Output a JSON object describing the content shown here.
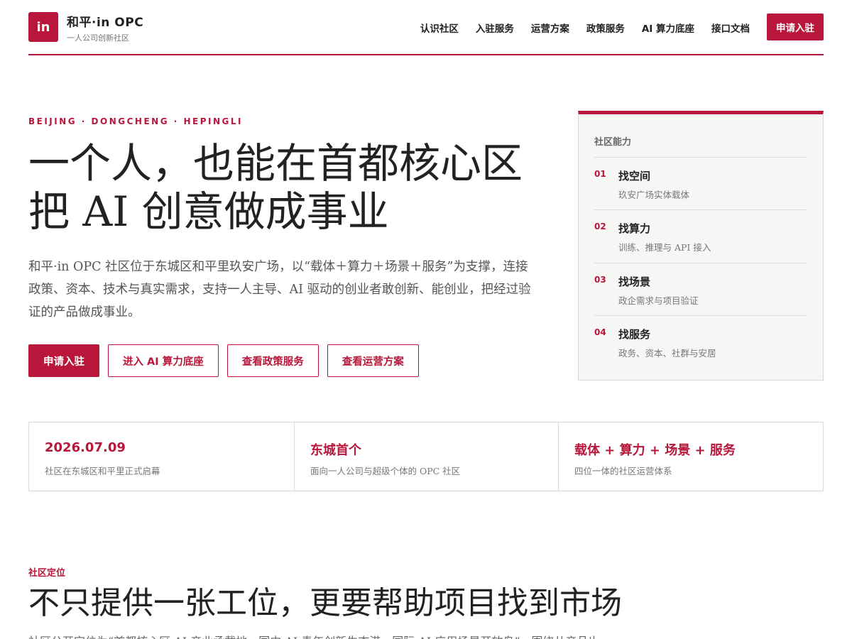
{
  "header": {
    "logo_text": "in",
    "brand_name": "和平·in OPC",
    "brand_sub": "一人公司创新社区",
    "nav": [
      {
        "label": "认识社区"
      },
      {
        "label": "入驻服务"
      },
      {
        "label": "运营方案"
      },
      {
        "label": "政策服务"
      },
      {
        "label": "AI 算力底座"
      },
      {
        "label": "接口文档"
      }
    ],
    "apply_label": "申请入驻"
  },
  "hero": {
    "eyebrow": "BEIJING · DONGCHENG · HEPINGLI",
    "title_line1": "一个人，也能在首都核心区",
    "title_line2": "把 AI 创意做成事业",
    "description": "和平·in OPC 社区位于东城区和平里玖安广场，以“载体＋算力＋场景＋服务”为支撑，连接政策、资本、技术与真实需求，支持一人主导、AI 驱动的创业者敢创新、能创业，把经过验证的产品做成事业。",
    "buttons": [
      {
        "label": "申请入驻"
      },
      {
        "label": "进入 AI 算力底座"
      },
      {
        "label": "查看政策服务"
      },
      {
        "label": "查看运营方案"
      }
    ]
  },
  "capabilities": {
    "title": "社区能力",
    "items": [
      {
        "num": "01",
        "title": "找空间",
        "desc": "玖安广场实体载体"
      },
      {
        "num": "02",
        "title": "找算力",
        "desc": "训练、推理与 API 接入"
      },
      {
        "num": "03",
        "title": "找场景",
        "desc": "政企需求与项目验证"
      },
      {
        "num": "04",
        "title": "找服务",
        "desc": "政务、资本、社群与安居"
      }
    ]
  },
  "stats": [
    {
      "value": "2026.07.09",
      "desc": "社区在东城区和平里正式启幕"
    },
    {
      "value": "东城首个",
      "desc": "面向一人公司与超级个体的 OPC 社区"
    },
    {
      "value": "载体 + 算力 + 场景 + 服务",
      "desc": "四位一体的社区运营体系"
    }
  ],
  "positioning": {
    "eyebrow": "社区定位",
    "title": "不只提供一张工位，更要帮助项目找到市场",
    "desc": "社区公开定位为“首都核心区 AI 产业承载地、国内 AI 青年创新生态港、国际 AI 应用场景开放岛”，围绕从产品出"
  },
  "colors": {
    "accent": "#b8163a",
    "card_bg": "#f6f6f4",
    "border": "#d8d8d8"
  }
}
